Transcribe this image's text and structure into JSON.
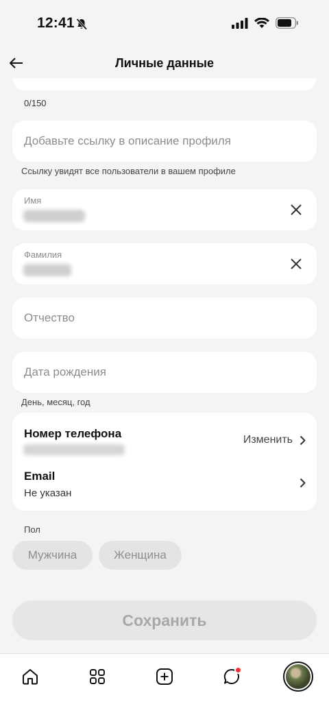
{
  "status_bar": {
    "time": "12:41"
  },
  "nav": {
    "title": "Личные данные"
  },
  "bio": {
    "counter": "0/150"
  },
  "link_field": {
    "placeholder": "Добавьте ссылку в описание профиля",
    "hint": "Ссылку увидят все пользователи в вашем профиле"
  },
  "first_name": {
    "label": "Имя"
  },
  "last_name": {
    "label": "Фамилия"
  },
  "middle_name": {
    "placeholder": "Отчество"
  },
  "birth_date": {
    "placeholder": "Дата рождения",
    "hint": "День, месяц, год"
  },
  "contacts": {
    "phone_title": "Номер телефона",
    "change_label": "Изменить",
    "email_title": "Email",
    "email_value": "Не указан"
  },
  "gender": {
    "label": "Пол",
    "options": [
      "Мужчина",
      "Женщина"
    ]
  },
  "save_label": "Сохранить",
  "tab_bar": {
    "items": [
      "home-icon",
      "catalog-grid-icon",
      "add-icon",
      "chat-icon",
      "profile-avatar"
    ],
    "badge_color": "#f0303a"
  }
}
